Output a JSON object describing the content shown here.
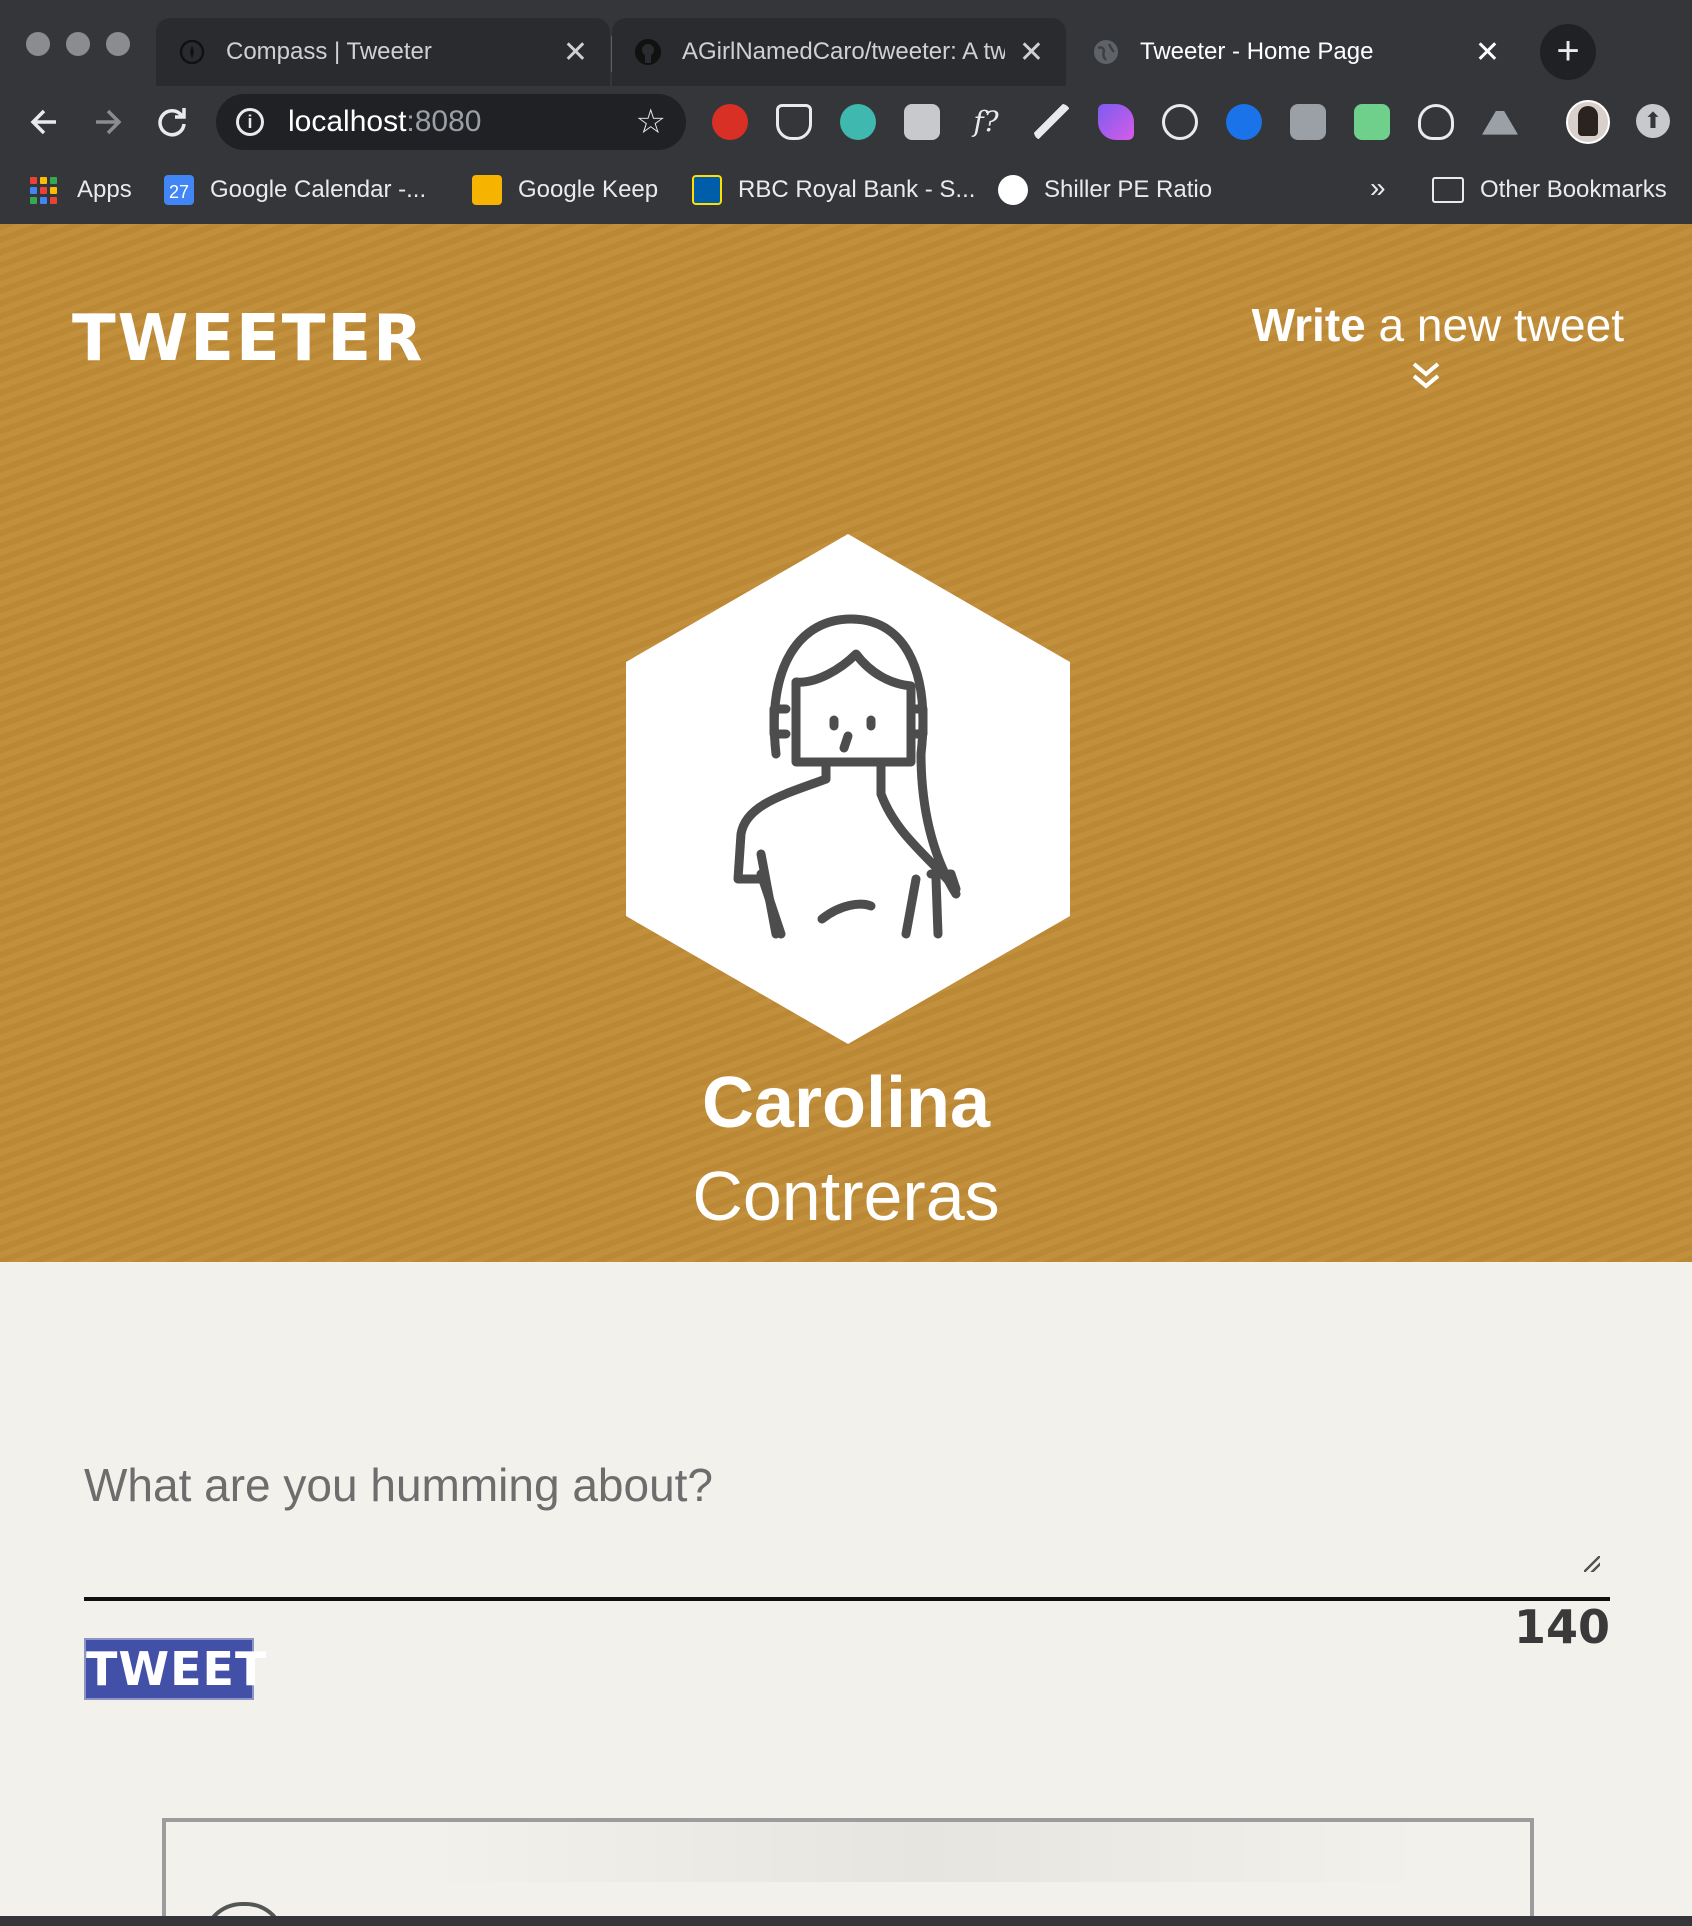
{
  "browser": {
    "tabs": [
      {
        "label": "Compass | Tweeter",
        "icon": "compass-icon",
        "active": false
      },
      {
        "label": "AGirlNamedCaro/tweeter: A twitter clone",
        "icon": "github-icon",
        "active": false
      },
      {
        "label": "Tweeter - Home Page",
        "icon": "globe-icon",
        "active": true
      }
    ],
    "close_glyph": "✕",
    "new_tab_glyph": "+",
    "address": {
      "host": "localhost",
      "port": ":8080"
    },
    "extension_icons": [
      "adblock-icon",
      "pocket-icon",
      "m-extension-icon",
      "h-extension-icon",
      "formula-icon",
      "pen-tool-icon",
      "feather-icon",
      "react-devtools-icon",
      "puzzle-icon",
      "photo-icon",
      "audio-icon",
      "bulb-icon",
      "drive-icon"
    ],
    "bookmarks": [
      {
        "label": "Apps",
        "icon": "apps-grid-icon"
      },
      {
        "label": "Google Calendar -...",
        "icon": "calendar-icon"
      },
      {
        "label": "Google Keep",
        "icon": "keep-icon"
      },
      {
        "label": "RBC Royal Bank - S...",
        "icon": "bank-icon"
      },
      {
        "label": "Shiller PE Ratio",
        "icon": "circle-icon"
      }
    ],
    "more_bookmarks": "»",
    "other_bookmarks": "Other Bookmarks",
    "calendar_day": "27"
  },
  "page": {
    "brand": "TWEETER",
    "compose_toggle": {
      "strong": "Write",
      "rest": " a new tweet"
    },
    "profile": {
      "first_name": "Carolina",
      "last_name": "Contreras"
    },
    "composer": {
      "placeholder": "What are you humming about?",
      "value": "",
      "counter": "140",
      "submit_label": "TWEET"
    }
  },
  "colors": {
    "header_bg": "#c18d38",
    "page_bg": "#f3f1ec",
    "tweet_button": "#4350a7"
  }
}
